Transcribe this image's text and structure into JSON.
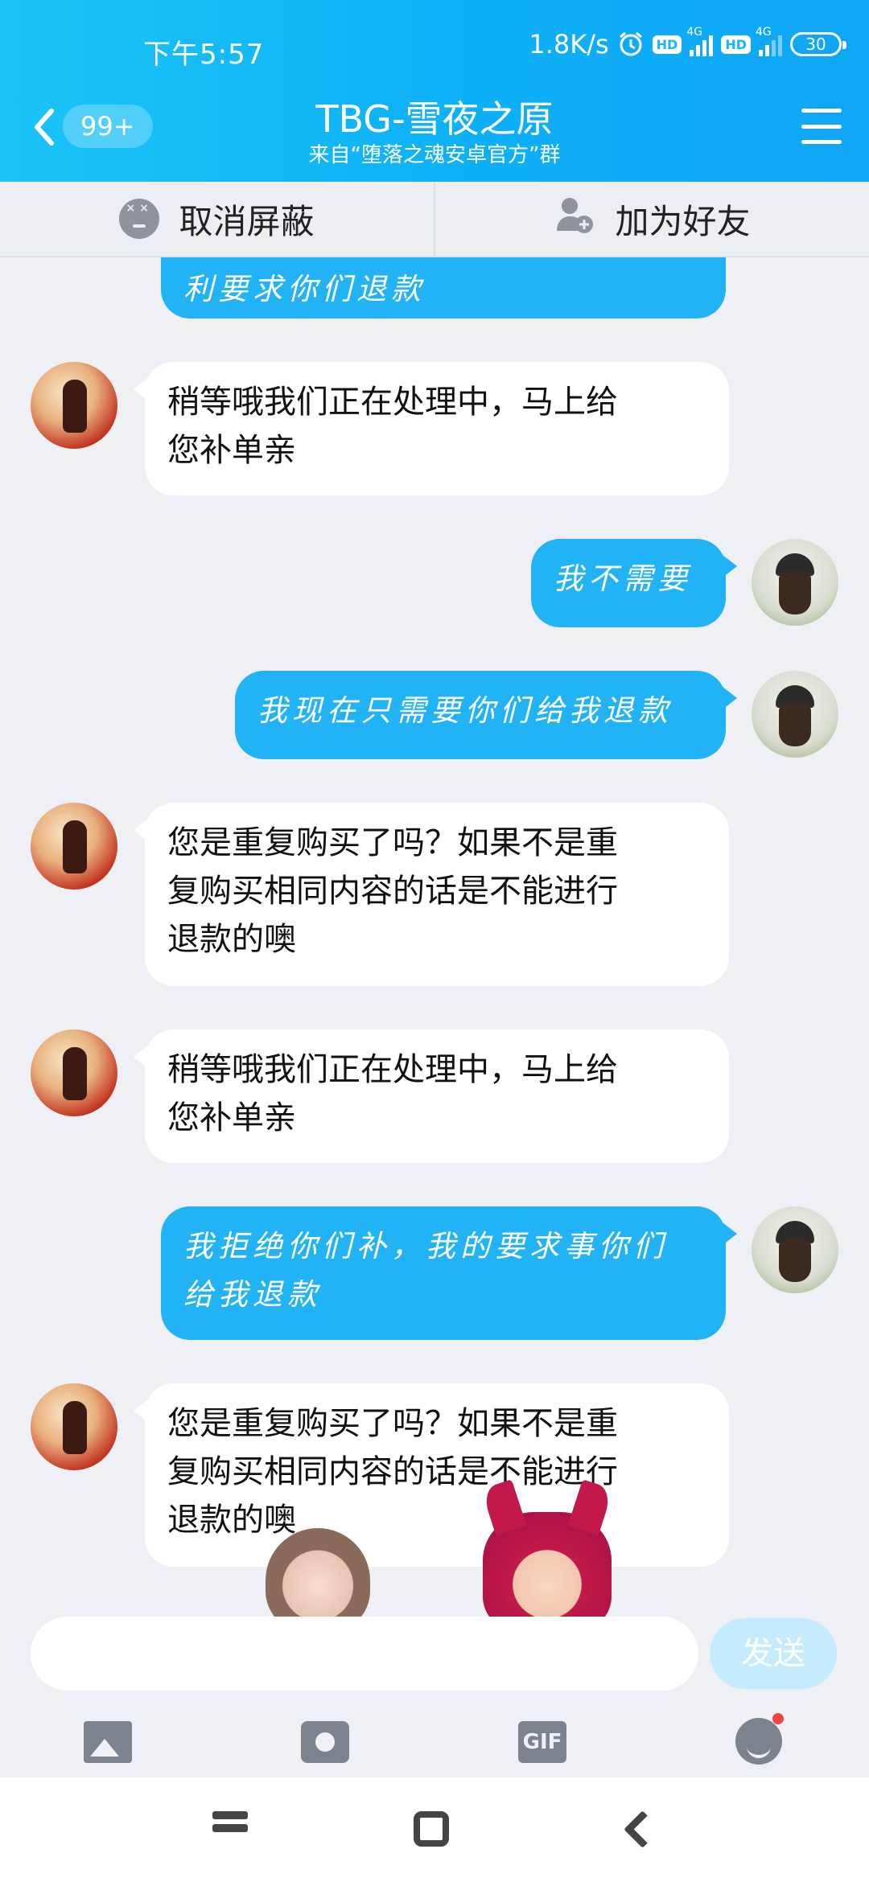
{
  "status_bar": {
    "time": "下午5:57",
    "net_speed": "1.8K/s",
    "hd1": "HD",
    "hd2": "HD",
    "net1": "4G",
    "net2": "4G",
    "battery": "30"
  },
  "header": {
    "unread_badge": "99+",
    "title": "TBG-雪夜之原",
    "subtitle": "来自“堕落之魂安卓官方”群"
  },
  "actions": {
    "unblock": "取消屏蔽",
    "add_friend": "加为好友"
  },
  "messages": [
    {
      "side": "right",
      "text": "利要求你们退款"
    },
    {
      "side": "left",
      "line1": "稍等哦我们正在处理中，马上给",
      "line2": "您补单亲"
    },
    {
      "side": "right",
      "text": "我不需要"
    },
    {
      "side": "right",
      "text": "我现在只需要你们给我退款"
    },
    {
      "side": "left",
      "line1": "您是重复购买了吗？如果不是重",
      "line2": "复购买相同内容的话是不能进行",
      "line3": "退款的噢"
    },
    {
      "side": "left",
      "line1": "稍等哦我们正在处理中，马上给",
      "line2": "您补单亲"
    },
    {
      "side": "right",
      "line1": "我拒绝你们补，我的要求事你们",
      "line2": "给我退款"
    },
    {
      "side": "left",
      "line1": "您是重复购买了吗？如果不是重",
      "line2": "复购买相同内容的话是不能进行",
      "line3": "退款的噢"
    }
  ],
  "input": {
    "placeholder": "",
    "send_label": "发送"
  },
  "tools": {
    "gif_label": "GIF"
  },
  "colors": {
    "header": "#12b6f6",
    "own_bubble": "#22b3f7",
    "other_bubble": "#ffffff",
    "background": "#eef0f5"
  }
}
